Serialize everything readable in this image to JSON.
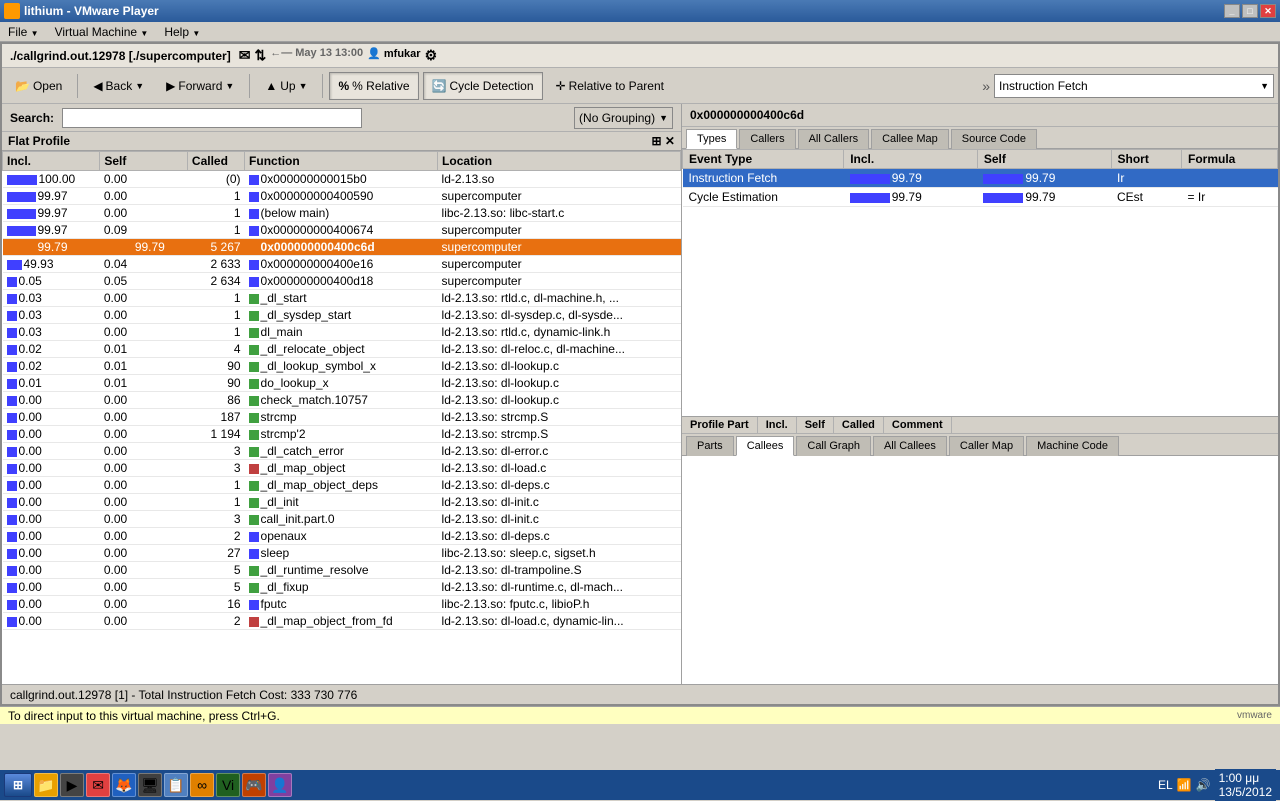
{
  "titlebar": {
    "title": "lithium - VMware Player",
    "menus": [
      "File",
      "Virtual Machine",
      "Help"
    ],
    "controls": [
      "_",
      "□",
      "✕"
    ]
  },
  "pathbar": {
    "path": "./callgrind.out.12978 [./supercomputer]"
  },
  "toolbar": {
    "open_label": "Open",
    "back_label": "Back",
    "forward_label": "Forward",
    "up_label": "Up",
    "relative_label": "% Relative",
    "cycle_label": "Cycle Detection",
    "rel_parent_label": "Relative to Parent",
    "instruction_fetch": "Instruction Fetch"
  },
  "searchbar": {
    "label": "Search:",
    "placeholder": "",
    "grouping": "(No Grouping)"
  },
  "flat_profile": {
    "title": "Flat Profile",
    "columns": [
      "Incl.",
      "Self",
      "Called",
      "Function",
      "Location"
    ],
    "rows": [
      {
        "incl": "100.00",
        "self": "0.00",
        "called": "(0)",
        "func": "0x000000000015b0",
        "loc": "ld-2.13.so",
        "color": "#4040ff",
        "barw1": 60,
        "barw2": 0
      },
      {
        "incl": "99.97",
        "self": "0.00",
        "called": "1",
        "func": "0x000000000400590",
        "loc": "supercomputer",
        "color": "#4040ff",
        "barw1": 58,
        "barw2": 0
      },
      {
        "incl": "99.97",
        "self": "0.00",
        "called": "1",
        "func": "(below main)",
        "loc": "libc-2.13.so: libc-start.c",
        "color": "#4040ff",
        "barw1": 58,
        "barw2": 0
      },
      {
        "incl": "99.97",
        "self": "0.09",
        "called": "1",
        "func": "0x000000000400674",
        "loc": "supercomputer",
        "color": "#4040ff",
        "barw1": 58,
        "barw2": 0
      },
      {
        "incl": "99.79",
        "self": "99.79",
        "called": "5 267",
        "func": "0x000000000400c6d",
        "loc": "supercomputer",
        "color": "#e87010",
        "barw1": 58,
        "barw2": 58,
        "selected": true
      },
      {
        "incl": "49.93",
        "self": "0.04",
        "called": "2 633",
        "func": "0x000000000400e16",
        "loc": "supercomputer",
        "color": "#4040ff",
        "barw1": 30,
        "barw2": 0
      },
      {
        "incl": "0.05",
        "self": "0.05",
        "called": "2 634",
        "func": "0x000000000400d18",
        "loc": "supercomputer",
        "color": "#4040ff",
        "barw1": 0,
        "barw2": 0
      },
      {
        "incl": "0.03",
        "self": "0.00",
        "called": "1",
        "func": "_dl_start",
        "loc": "ld-2.13.so: rtld.c, dl-machine.h, ...",
        "color": "#40a040",
        "barw1": 0,
        "barw2": 0
      },
      {
        "incl": "0.03",
        "self": "0.00",
        "called": "1",
        "func": "_dl_sysdep_start",
        "loc": "ld-2.13.so: dl-sysdep.c, dl-sysde...",
        "color": "#40a040",
        "barw1": 0,
        "barw2": 0
      },
      {
        "incl": "0.03",
        "self": "0.00",
        "called": "1",
        "func": "dl_main",
        "loc": "ld-2.13.so: rtld.c, dynamic-link.h",
        "color": "#40a040",
        "barw1": 0,
        "barw2": 0
      },
      {
        "incl": "0.02",
        "self": "0.01",
        "called": "4",
        "func": "_dl_relocate_object",
        "loc": "ld-2.13.so: dl-reloc.c, dl-machine...",
        "color": "#40a040",
        "barw1": 0,
        "barw2": 0
      },
      {
        "incl": "0.02",
        "self": "0.01",
        "called": "90",
        "func": "_dl_lookup_symbol_x",
        "loc": "ld-2.13.so: dl-lookup.c",
        "color": "#40a040",
        "barw1": 0,
        "barw2": 0
      },
      {
        "incl": "0.01",
        "self": "0.01",
        "called": "90",
        "func": "do_lookup_x",
        "loc": "ld-2.13.so: dl-lookup.c",
        "color": "#40a040",
        "barw1": 0,
        "barw2": 0
      },
      {
        "incl": "0.00",
        "self": "0.00",
        "called": "86",
        "func": "check_match.10757",
        "loc": "ld-2.13.so: dl-lookup.c",
        "color": "#40a040",
        "barw1": 0,
        "barw2": 0
      },
      {
        "incl": "0.00",
        "self": "0.00",
        "called": "187",
        "func": "strcmp",
        "loc": "ld-2.13.so: strcmp.S",
        "color": "#40a040",
        "barw1": 0,
        "barw2": 0
      },
      {
        "incl": "0.00",
        "self": "0.00",
        "called": "1 194",
        "func": "strcmp'2",
        "loc": "ld-2.13.so: strcmp.S",
        "color": "#40a040",
        "barw1": 0,
        "barw2": 0
      },
      {
        "incl": "0.00",
        "self": "0.00",
        "called": "3",
        "func": "_dl_catch_error",
        "loc": "ld-2.13.so: dl-error.c",
        "color": "#40a040",
        "barw1": 0,
        "barw2": 0
      },
      {
        "incl": "0.00",
        "self": "0.00",
        "called": "3",
        "func": "_dl_map_object",
        "loc": "ld-2.13.so: dl-load.c",
        "color": "#c04040",
        "barw1": 0,
        "barw2": 0
      },
      {
        "incl": "0.00",
        "self": "0.00",
        "called": "1",
        "func": "_dl_map_object_deps",
        "loc": "ld-2.13.so: dl-deps.c",
        "color": "#40a040",
        "barw1": 0,
        "barw2": 0
      },
      {
        "incl": "0.00",
        "self": "0.00",
        "called": "1",
        "func": "_dl_init",
        "loc": "ld-2.13.so: dl-init.c",
        "color": "#40a040",
        "barw1": 0,
        "barw2": 0
      },
      {
        "incl": "0.00",
        "self": "0.00",
        "called": "3",
        "func": "call_init.part.0",
        "loc": "ld-2.13.so: dl-init.c",
        "color": "#40a040",
        "barw1": 0,
        "barw2": 0
      },
      {
        "incl": "0.00",
        "self": "0.00",
        "called": "2",
        "func": "openaux",
        "loc": "ld-2.13.so: dl-deps.c",
        "color": "#4040ff",
        "barw1": 0,
        "barw2": 0
      },
      {
        "incl": "0.00",
        "self": "0.00",
        "called": "27",
        "func": "sleep",
        "loc": "libc-2.13.so: sleep.c, sigset.h",
        "color": "#4040ff",
        "barw1": 0,
        "barw2": 0
      },
      {
        "incl": "0.00",
        "self": "0.00",
        "called": "5",
        "func": "_dl_runtime_resolve",
        "loc": "ld-2.13.so: dl-trampoline.S",
        "color": "#40a040",
        "barw1": 0,
        "barw2": 0
      },
      {
        "incl": "0.00",
        "self": "0.00",
        "called": "5",
        "func": "_dl_fixup",
        "loc": "ld-2.13.so: dl-runtime.c, dl-mach...",
        "color": "#40a040",
        "barw1": 0,
        "barw2": 0
      },
      {
        "incl": "0.00",
        "self": "0.00",
        "called": "16",
        "func": "fputc",
        "loc": "libc-2.13.so: fputc.c, libioP.h",
        "color": "#4040ff",
        "barw1": 0,
        "barw2": 0
      },
      {
        "incl": "0.00",
        "self": "0.00",
        "called": "2",
        "func": "_dl_map_object_from_fd",
        "loc": "ld-2.13.so: dl-load.c, dynamic-lin...",
        "color": "#c04040",
        "barw1": 0,
        "barw2": 0
      }
    ]
  },
  "right_panel": {
    "address": "0x000000000400c6d",
    "tabs": [
      "Types",
      "Callers",
      "All Callers",
      "Callee Map",
      "Source Code"
    ],
    "active_tab": "Types",
    "event_table": {
      "columns": [
        "Event Type",
        "Incl.",
        "Self",
        "Short",
        "Formula"
      ],
      "rows": [
        {
          "type": "Instruction Fetch",
          "incl": "99.79",
          "self": "99.79",
          "short": "Ir",
          "formula": "",
          "selected": true
        },
        {
          "type": "Cycle Estimation",
          "incl": "99.79",
          "self": "99.79",
          "short": "CEst",
          "formula": "= Ir",
          "selected": false
        }
      ]
    },
    "bottom_tabs": [
      "Parts",
      "Callees",
      "Call Graph",
      "All Callees",
      "Caller Map",
      "Machine Code"
    ],
    "active_bottom_tab": "Callees",
    "bottom_header": {
      "cols": [
        "Profile Part",
        "Incl.",
        "Self",
        "Called",
        "Comment"
      ]
    }
  },
  "statusbar": {
    "text": "callgrind.out.12978 [1] - Total Instruction Fetch Cost: 333 730 776"
  },
  "input_hint": {
    "text": "To direct input to this virtual machine, press Ctrl+G."
  },
  "taskbar": {
    "start_label": "",
    "time": "1:00 μμ",
    "date": "13/5/2012",
    "lang": "EL",
    "icons": [
      "🖥",
      "📁",
      "▶",
      "✉",
      "🦊",
      "🖥",
      "📋",
      "⬡",
      "🖊",
      "🎮",
      "👤"
    ]
  }
}
